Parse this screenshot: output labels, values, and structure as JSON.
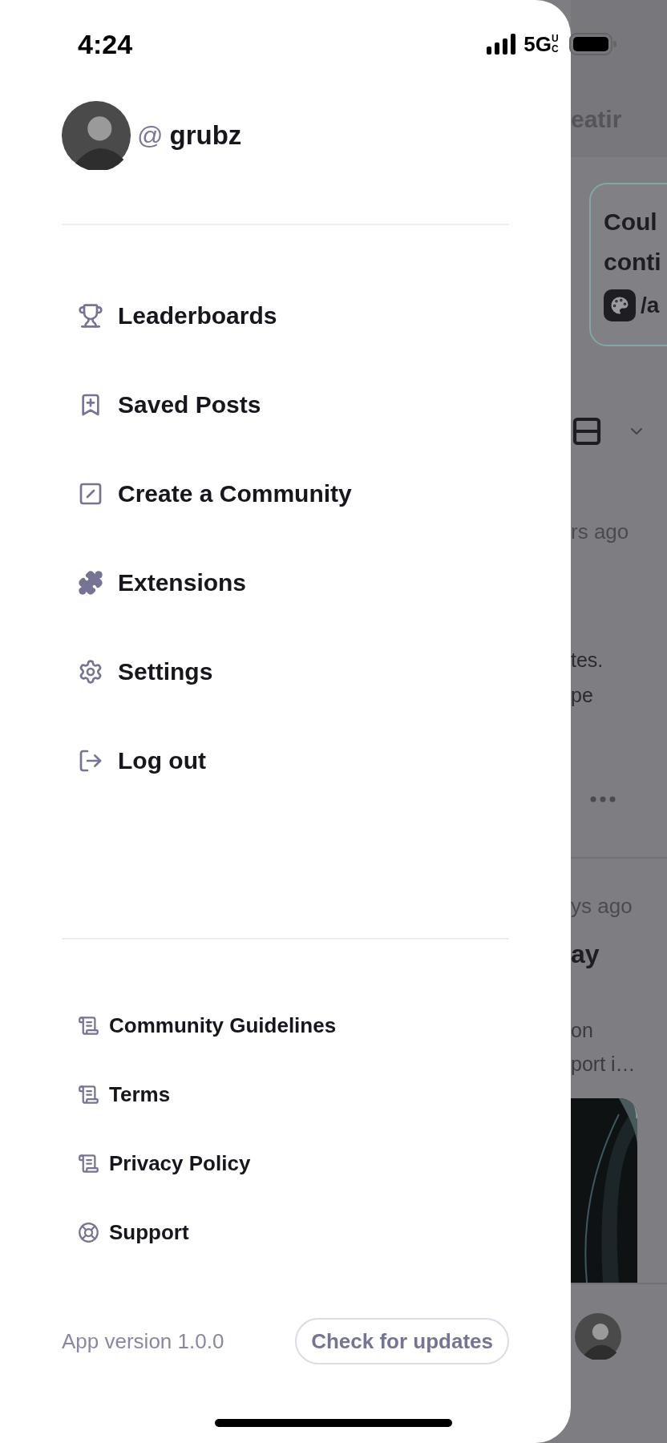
{
  "status_bar": {
    "time": "4:24",
    "network": "5G",
    "network_badge": "UC"
  },
  "profile": {
    "at": "@",
    "username": "grubz"
  },
  "menu": [
    {
      "label": "Leaderboards"
    },
    {
      "label": "Saved Posts"
    },
    {
      "label": "Create a Community"
    },
    {
      "label": "Extensions"
    },
    {
      "label": "Settings"
    },
    {
      "label": "Log out"
    }
  ],
  "links": [
    {
      "label": "Community Guidelines"
    },
    {
      "label": "Terms"
    },
    {
      "label": "Privacy Policy"
    },
    {
      "label": "Support"
    }
  ],
  "footer": {
    "version": "App version 1.0.0",
    "button": "Check for updates"
  },
  "background": {
    "header_fragment": "eatir",
    "card": {
      "lines": [
        "Coul",
        "conti"
      ],
      "community": "/a"
    },
    "post_1": {
      "time": "rs ago",
      "lines": [
        "tes.",
        "pe"
      ]
    },
    "post_2": {
      "time": "ys ago",
      "title": "ay",
      "lines": [
        "on",
        "port i…"
      ]
    }
  }
}
